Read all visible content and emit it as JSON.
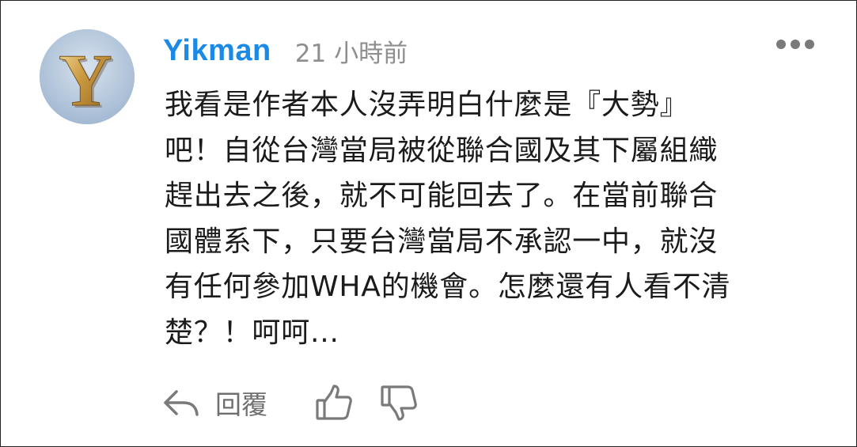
{
  "comment": {
    "author": "Yikman",
    "avatar_letter": "Y",
    "timestamp": "21 小時前",
    "text": "我看是作者本人沒弄明白什麼是『大勢』\n吧！自從台灣當局被從聯合國及其下屬組織\n趕出去之後，就不可能回去了。在當前聯合\n國體系下，只要台灣當局不承認一中，就沒\n有任何參加WHA的機會。怎麼還有人看不清\n楚？！呵呵...",
    "more_icon": "more-horizontal-icon"
  },
  "actions": {
    "reply_label": "回覆",
    "reply_icon": "reply-arrow-icon",
    "like_icon": "thumbs-up-icon",
    "dislike_icon": "thumbs-down-icon"
  },
  "colors": {
    "username": "#1a8ae6",
    "timestamp": "#8e8e8e",
    "body_text": "#1b1b1b",
    "icon_gray": "#7a7a7a"
  }
}
